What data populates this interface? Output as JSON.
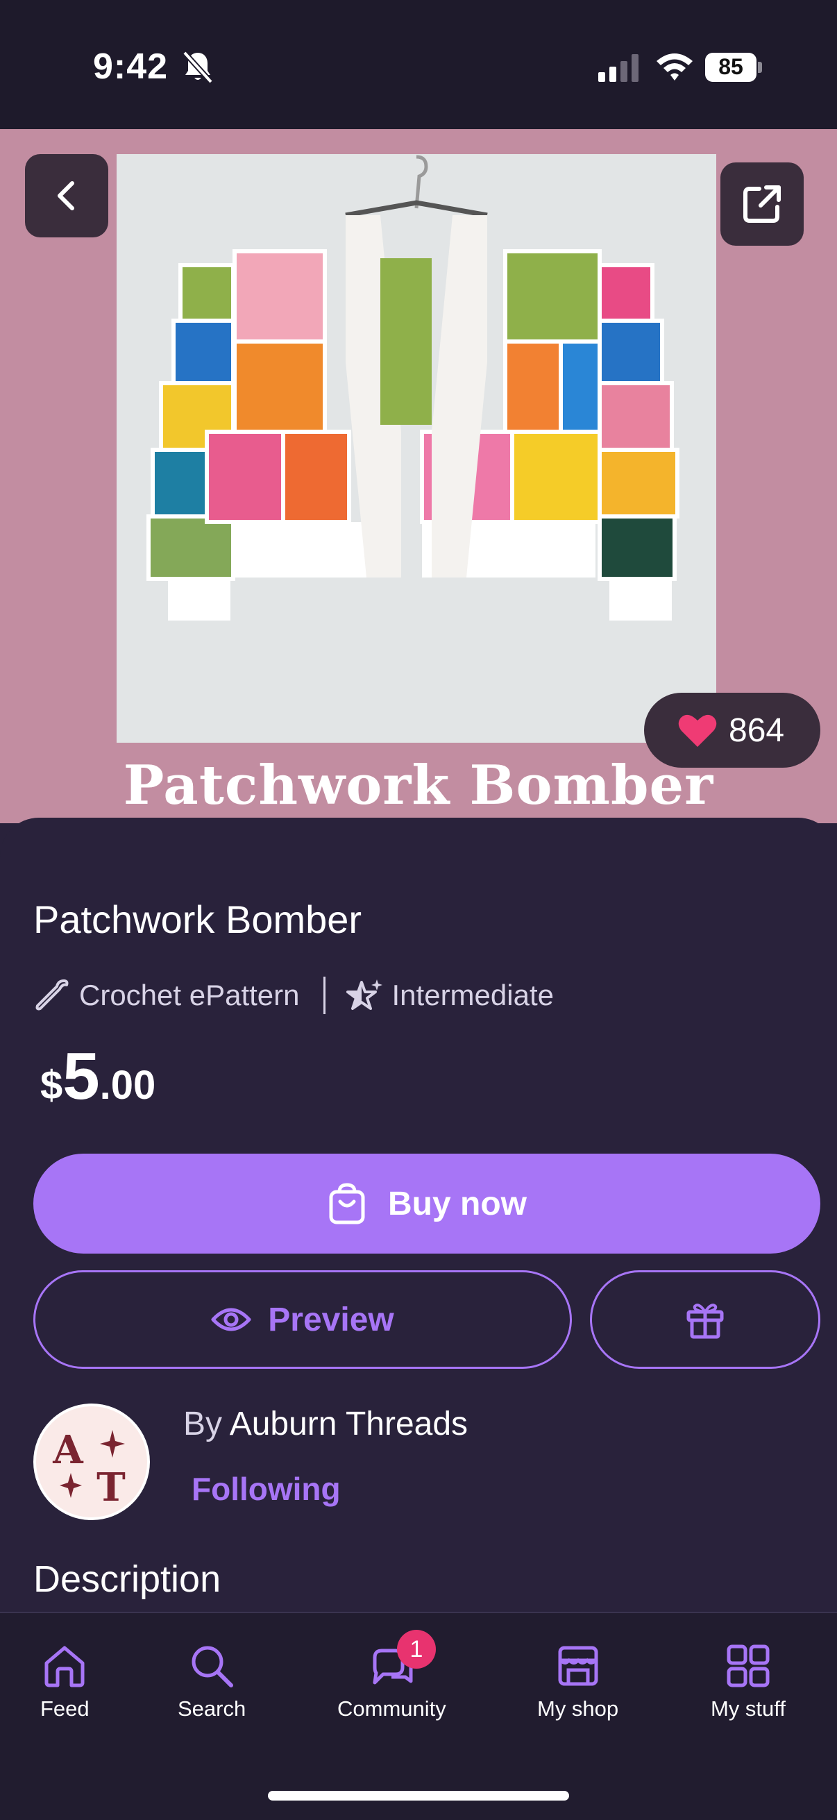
{
  "status_bar": {
    "time": "9:42",
    "battery": "85",
    "icons": [
      "bell-slash-icon",
      "signal-icon",
      "wifi-icon",
      "battery-icon"
    ]
  },
  "hero": {
    "overlay_title": "Patchwork Bomber",
    "likes": "864",
    "background_color": "#c28da1",
    "icons": [
      "back-chevron-icon",
      "share-icon",
      "heart-icon"
    ]
  },
  "product": {
    "title": "Patchwork Bomber",
    "type": "Crochet ePattern",
    "difficulty": "Intermediate",
    "price": {
      "symbol": "$",
      "whole": "5",
      "cents": ".00"
    }
  },
  "actions": {
    "buy_label": "Buy now",
    "preview_label": "Preview",
    "gift_icon": "gift-icon"
  },
  "seller": {
    "prefix": "By",
    "name": "Auburn Threads",
    "follow_status": "Following"
  },
  "sections": {
    "description_heading": "Description"
  },
  "tab_bar": {
    "tabs": [
      {
        "label": "Feed",
        "icon": "home-icon"
      },
      {
        "label": "Search",
        "icon": "search-icon"
      },
      {
        "label": "Community",
        "icon": "chat-icon",
        "badge": "1"
      },
      {
        "label": "My shop",
        "icon": "store-icon"
      },
      {
        "label": "My stuff",
        "icon": "grid-icon"
      }
    ]
  },
  "colors": {
    "accent": "#a775f6",
    "background": "#29223b",
    "hero": "#c28da1",
    "badge": "#e8336f",
    "heart": "#ef3b74"
  }
}
